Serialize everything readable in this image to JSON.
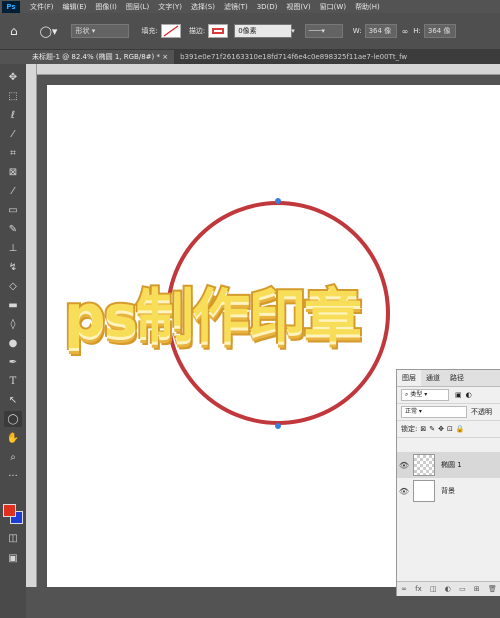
{
  "menu": {
    "logo": "Ps",
    "items": [
      "文件(F)",
      "编辑(E)",
      "图像(I)",
      "图层(L)",
      "文字(Y)",
      "选择(S)",
      "滤镜(T)",
      "3D(D)",
      "视图(V)",
      "窗口(W)",
      "帮助(H)"
    ]
  },
  "options": {
    "mode": "形状",
    "fill_label": "填充:",
    "stroke_label": "描边:",
    "stroke_width": "0像素",
    "w_label": "W:",
    "w_value": "364 像",
    "h_label": "H:",
    "h_value": "364 像",
    "stroke_color": "#d93a3a"
  },
  "tabs": [
    {
      "label": "未标题-1 @ 82.4% (椭圆 1, RGB/8#) *"
    },
    {
      "label": "b391e0e71f26163310e18fd714f6e4c0e898325f11ae7-le00Tt_fw"
    }
  ],
  "artwork": {
    "title_text": "ps制作印章",
    "seal_color": "#c0373c",
    "title_fill": "#f8de58"
  },
  "layers_panel": {
    "tabs": [
      "图层",
      "通道",
      "路径"
    ],
    "filter_label": "类型",
    "blend_mode": "正常",
    "opacity_label": "不透明",
    "lock_label": "锁定:",
    "layers": [
      {
        "name": "椭圆 1",
        "selected": true
      },
      {
        "name": "背景",
        "selected": false
      }
    ]
  },
  "tools": [
    "move-icon",
    "marquee-icon",
    "lasso-icon",
    "magic-wand-icon",
    "crop-icon",
    "frame-icon",
    "eyedropper-icon",
    "healing-icon",
    "brush-icon",
    "stamp-icon",
    "history-brush-icon",
    "eraser-icon",
    "gradient-icon",
    "blur-icon",
    "dodge-icon",
    "pen-icon",
    "type-icon",
    "path-select-icon",
    "ellipse-icon",
    "hand-icon",
    "zoom-icon",
    "more-icon"
  ],
  "colors": {
    "foreground": "#e03020",
    "background": "#1b3fd6"
  }
}
